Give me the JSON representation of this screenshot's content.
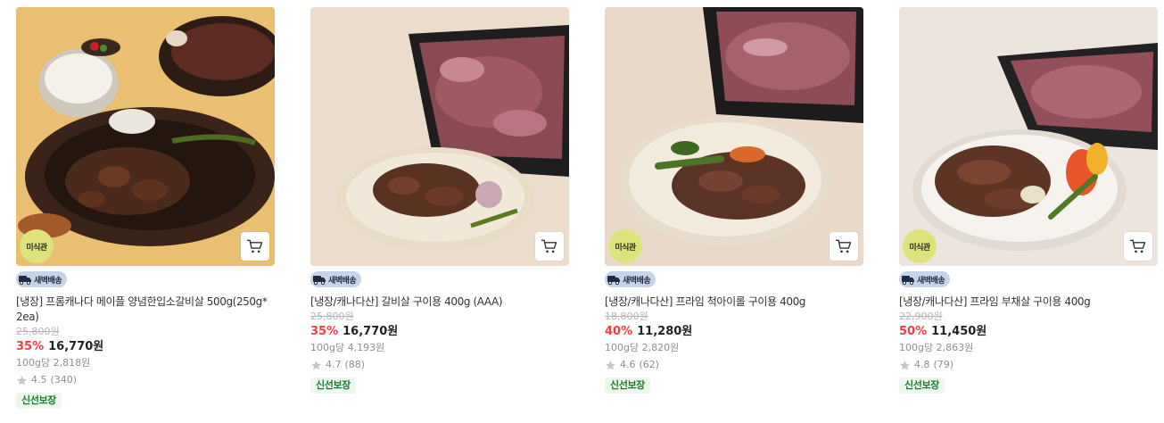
{
  "colors": {
    "discount": "#fa3b3b",
    "fresh_text": "#1e7a33",
    "fresh_bg": "#eef7ee",
    "delivery_bg": "#c7d3e6",
    "badge_bg": "#dde37a"
  },
  "products": [
    {
      "badge": "미식관",
      "delivery": "새벽배송",
      "title": "[냉장] 프롬캐나다 메이플 양념한입소갈비살 500g(250g*2ea)",
      "original_price": "25,800원",
      "discount": "35%",
      "price": "16,770원",
      "unit_price": "100g당 2,818원",
      "rating": "4.5",
      "reviews": "(340)",
      "tag": "신선보장",
      "image_icon": "meat-photo"
    },
    {
      "badge": "",
      "delivery": "새벽배송",
      "title": "[냉장/캐나다산] 갈비살 구이용 400g (AAA)",
      "original_price": "25,800원",
      "discount": "35%",
      "price": "16,770원",
      "unit_price": "100g당 4,193원",
      "rating": "4.7",
      "reviews": "(88)",
      "tag": "신선보장",
      "image_icon": "meat-photo"
    },
    {
      "badge": "미식관",
      "delivery": "새벽배송",
      "title": "[냉장/캐나다산] 프라임 척아이롤 구이용 400g",
      "original_price": "18,800원",
      "discount": "40%",
      "price": "11,280원",
      "unit_price": "100g당 2,820원",
      "rating": "4.6",
      "reviews": "(62)",
      "tag": "신선보장",
      "image_icon": "meat-photo"
    },
    {
      "badge": "미식관",
      "delivery": "새벽배송",
      "title": "[냉장/캐나다산] 프라임 부채살 구이용 400g",
      "original_price": "22,900원",
      "discount": "50%",
      "price": "11,450원",
      "unit_price": "100g당 2,863원",
      "rating": "4.8",
      "reviews": "(79)",
      "tag": "신선보장",
      "image_icon": "meat-photo"
    }
  ]
}
